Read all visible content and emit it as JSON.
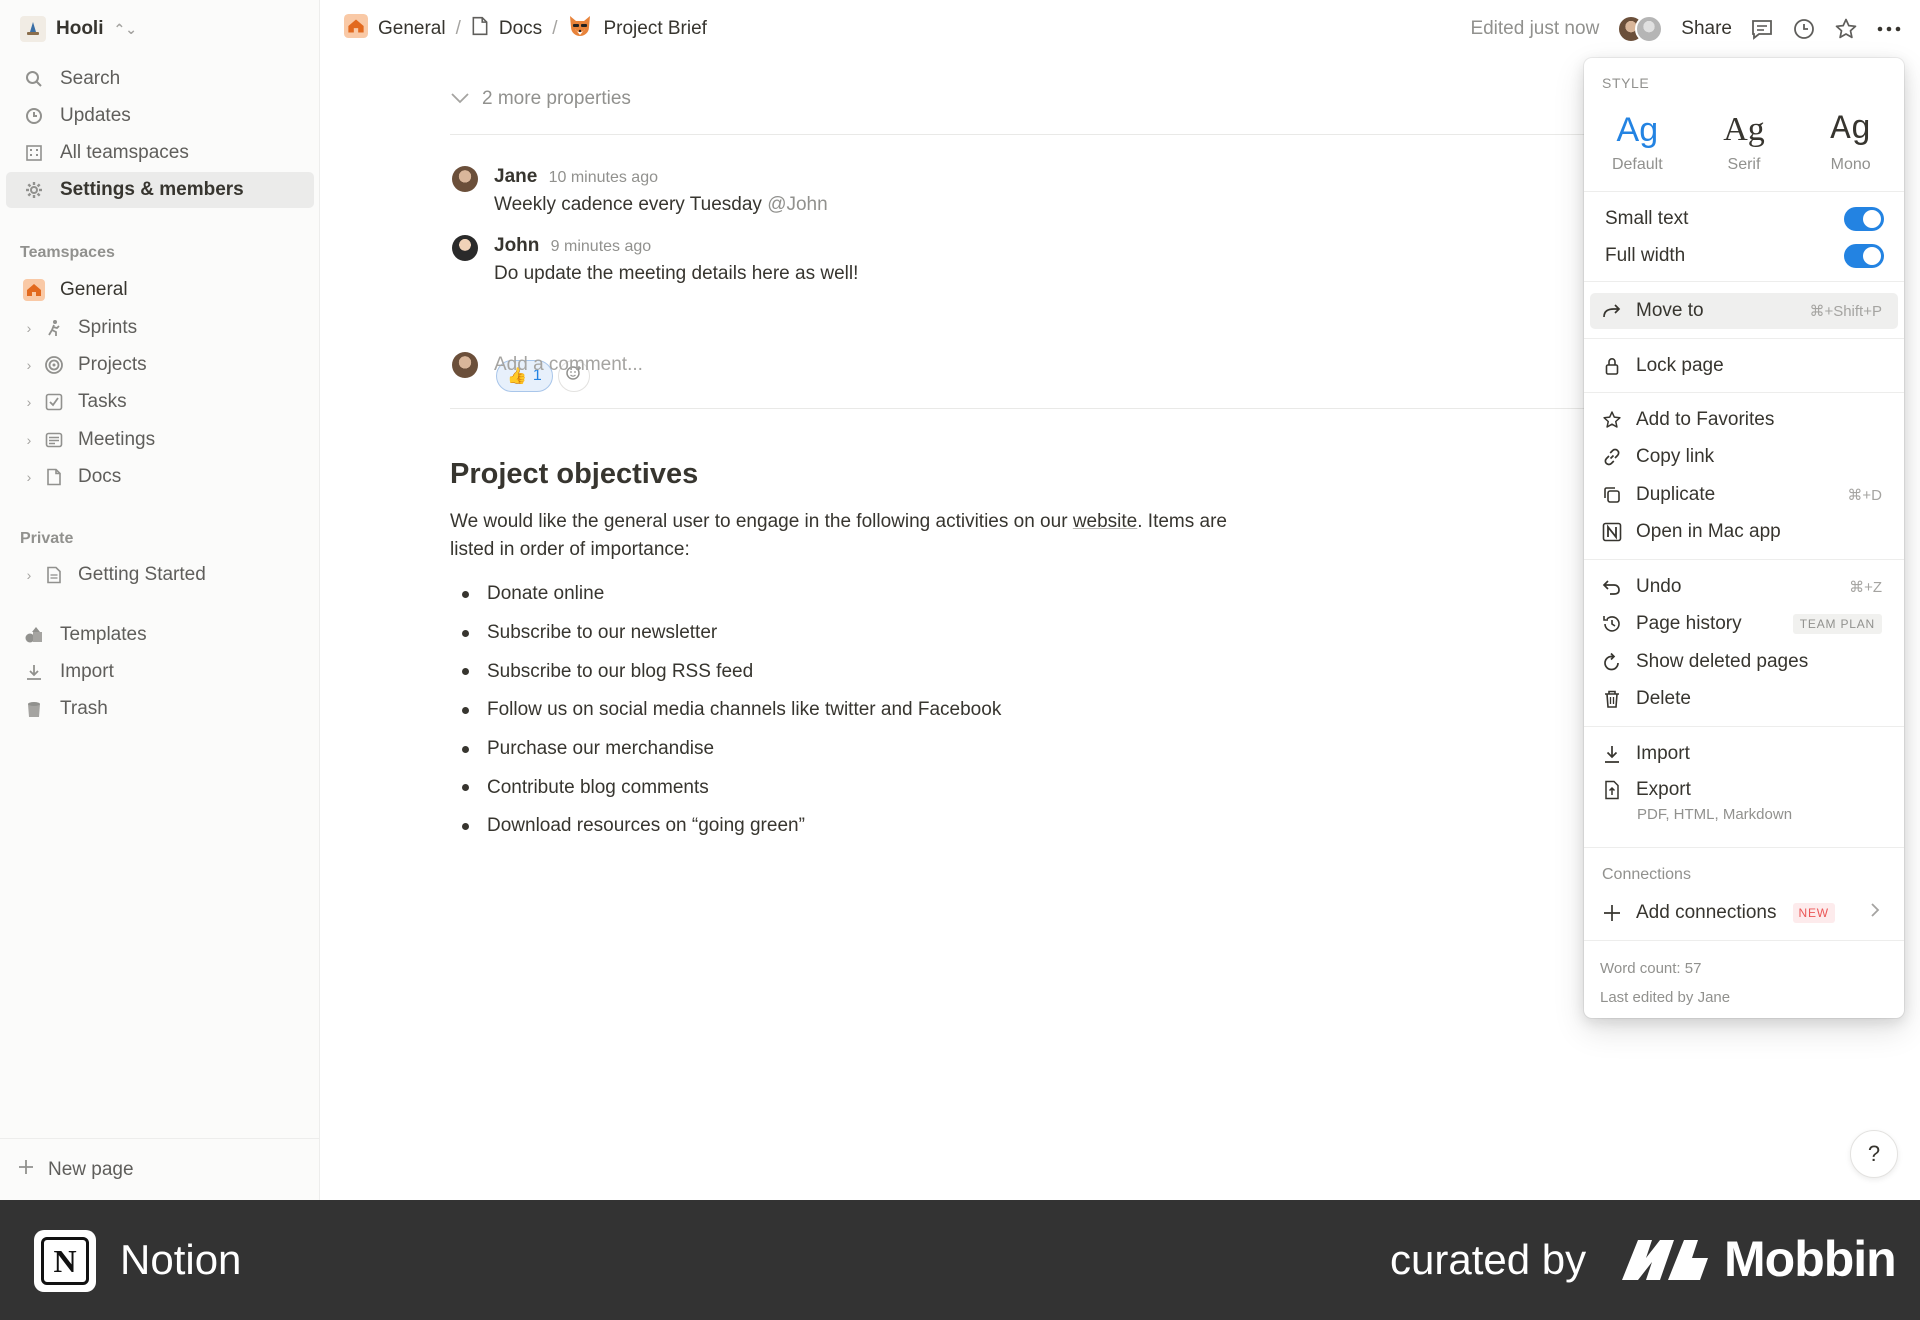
{
  "workspace": {
    "name": "Hooli"
  },
  "sidebar": {
    "top_items": [
      {
        "label": "Search",
        "icon": "search-icon"
      },
      {
        "label": "Updates",
        "icon": "clock-icon"
      },
      {
        "label": "All teamspaces",
        "icon": "building-icon"
      },
      {
        "label": "Settings & members",
        "icon": "gear-icon"
      }
    ],
    "teamspaces_label": "Teamspaces",
    "teamspaces": [
      {
        "label": "General",
        "icon": "home-icon"
      },
      {
        "label": "Sprints",
        "icon": "runner-icon"
      },
      {
        "label": "Projects",
        "icon": "target-icon"
      },
      {
        "label": "Tasks",
        "icon": "checkbox-icon"
      },
      {
        "label": "Meetings",
        "icon": "notes-icon"
      },
      {
        "label": "Docs",
        "icon": "page-icon"
      }
    ],
    "private_label": "Private",
    "private": [
      {
        "label": "Getting Started",
        "icon": "document-icon"
      }
    ],
    "bottom_items": [
      {
        "label": "Templates",
        "icon": "shapes-icon"
      },
      {
        "label": "Import",
        "icon": "download-icon"
      },
      {
        "label": "Trash",
        "icon": "trash-icon"
      }
    ],
    "new_page": "New page"
  },
  "topbar": {
    "breadcrumb": [
      {
        "label": "General",
        "icon": "home-icon"
      },
      {
        "label": "Docs",
        "icon": "page-icon"
      },
      {
        "label": "Project Brief",
        "icon": "fox-emoji-icon"
      }
    ],
    "separator": "/",
    "edited": "Edited just now",
    "share": "Share"
  },
  "doc": {
    "more_properties": "2 more properties",
    "comments": [
      {
        "name": "Jane",
        "time": "10 minutes ago",
        "text": "Weekly cadence every Tuesday ",
        "mention": "@John"
      },
      {
        "name": "John",
        "time": "9 minutes ago",
        "text": "Do update the meeting details here as well!"
      }
    ],
    "reaction": {
      "emoji": "👍",
      "count": "1"
    },
    "add_comment_placeholder": "Add a comment...",
    "heading": "Project objectives",
    "paragraph_before": "We would like the general user to engage in the following activities on our ",
    "paragraph_link": "website",
    "paragraph_after": ". Items are listed in order of importance:",
    "bullets": [
      "Donate online",
      "Subscribe to our newsletter",
      "Subscribe to our blog RSS feed",
      "Follow us on social media channels like twitter and Facebook",
      "Purchase our merchandise",
      "Contribute blog comments",
      "Download resources on “going green”"
    ],
    "help": "?"
  },
  "menu": {
    "style_label": "STYLE",
    "styles": [
      {
        "glyph": "Ag",
        "name": "Default",
        "selected": true
      },
      {
        "glyph": "Ag",
        "name": "Serif",
        "selected": false
      },
      {
        "glyph": "Ag",
        "name": "Mono",
        "selected": false
      }
    ],
    "toggles": [
      {
        "label": "Small text",
        "on": true
      },
      {
        "label": "Full width",
        "on": true
      }
    ],
    "move_to": {
      "label": "Move to",
      "shortcut": "⌘+Shift+P"
    },
    "lock_page": "Lock page",
    "add_favorites": "Add to Favorites",
    "copy_link": "Copy link",
    "duplicate": {
      "label": "Duplicate",
      "shortcut": "⌘+D"
    },
    "open_mac": "Open in Mac app",
    "undo": {
      "label": "Undo",
      "shortcut": "⌘+Z"
    },
    "page_history": {
      "label": "Page history",
      "badge": "TEAM PLAN"
    },
    "show_deleted": "Show deleted pages",
    "delete": "Delete",
    "import": "Import",
    "export": {
      "label": "Export",
      "sub": "PDF, HTML, Markdown"
    },
    "connections_label": "Connections",
    "add_connections": {
      "label": "Add connections",
      "badge": "NEW"
    },
    "word_count": "Word count: 57",
    "last_edited": "Last edited by Jane"
  },
  "colors": {
    "accent": "#2383e2",
    "banner": "#333333"
  },
  "banner": {
    "app_name": "Notion",
    "curated_by": "curated by",
    "brand": "Mobbin"
  }
}
